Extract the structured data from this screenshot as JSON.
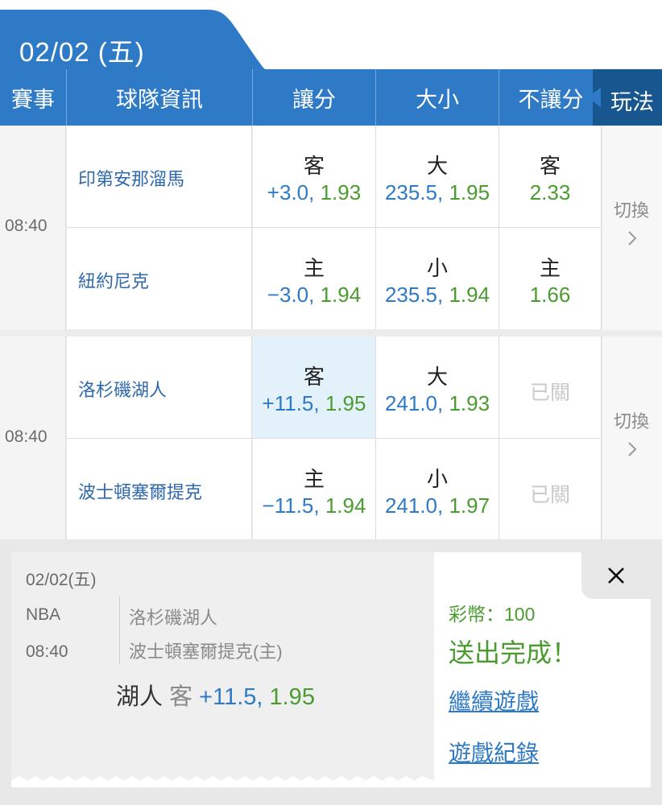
{
  "date": {
    "label": "02/02 (五)"
  },
  "header": {
    "event": "賽事",
    "team_info": "球隊資訊",
    "spread": "讓分",
    "total": "大小",
    "moneyline": "不讓分",
    "play": "玩法"
  },
  "games": [
    {
      "time": "08:40",
      "switch_label": "切換",
      "rows": [
        {
          "team": "印第安那溜馬",
          "spread_label": "客",
          "spread_line": "+3.0, ",
          "spread_odds": "1.93",
          "total_label": "大",
          "total_line": "235.5, ",
          "total_odds": "1.95",
          "ml_label": "客",
          "ml_odds": "2.33"
        },
        {
          "team": "紐約尼克",
          "spread_label": "主",
          "spread_line": "−3.0, ",
          "spread_odds": "1.94",
          "total_label": "小",
          "total_line": "235.5, ",
          "total_odds": "1.94",
          "ml_label": "主",
          "ml_odds": "1.66"
        }
      ]
    },
    {
      "time": "08:40",
      "switch_label": "切換",
      "rows": [
        {
          "team": "洛杉磯湖人",
          "spread_label": "客",
          "spread_line": "+11.5, ",
          "spread_odds": "1.95",
          "total_label": "大",
          "total_line": "241.0, ",
          "total_odds": "1.93",
          "ml_closed": "已關"
        },
        {
          "team": "波士頓塞爾提克",
          "spread_label": "主",
          "spread_line": "−11.5, ",
          "spread_odds": "1.94",
          "total_label": "小",
          "total_line": "241.0, ",
          "total_odds": "1.97",
          "ml_closed": "已關"
        }
      ]
    }
  ],
  "ticket": {
    "date": "02/02(五)",
    "league": "NBA",
    "time": "08:40",
    "away_team": "洛杉磯湖人",
    "home_team": "波士頓塞爾提克(主)",
    "pick_team": "湖人",
    "pick_side": "客",
    "pick_line": "+11.5, ",
    "pick_odds": "1.95"
  },
  "result": {
    "coins": "彩幣：100",
    "status": "送出完成！",
    "continue_link": "繼續遊戲",
    "history_link": "遊戲紀錄"
  },
  "colors": {
    "primary": "#2f7ac6",
    "dark": "#17568f",
    "green": "#4a9c2f",
    "highlight": "#e3f1fb"
  }
}
